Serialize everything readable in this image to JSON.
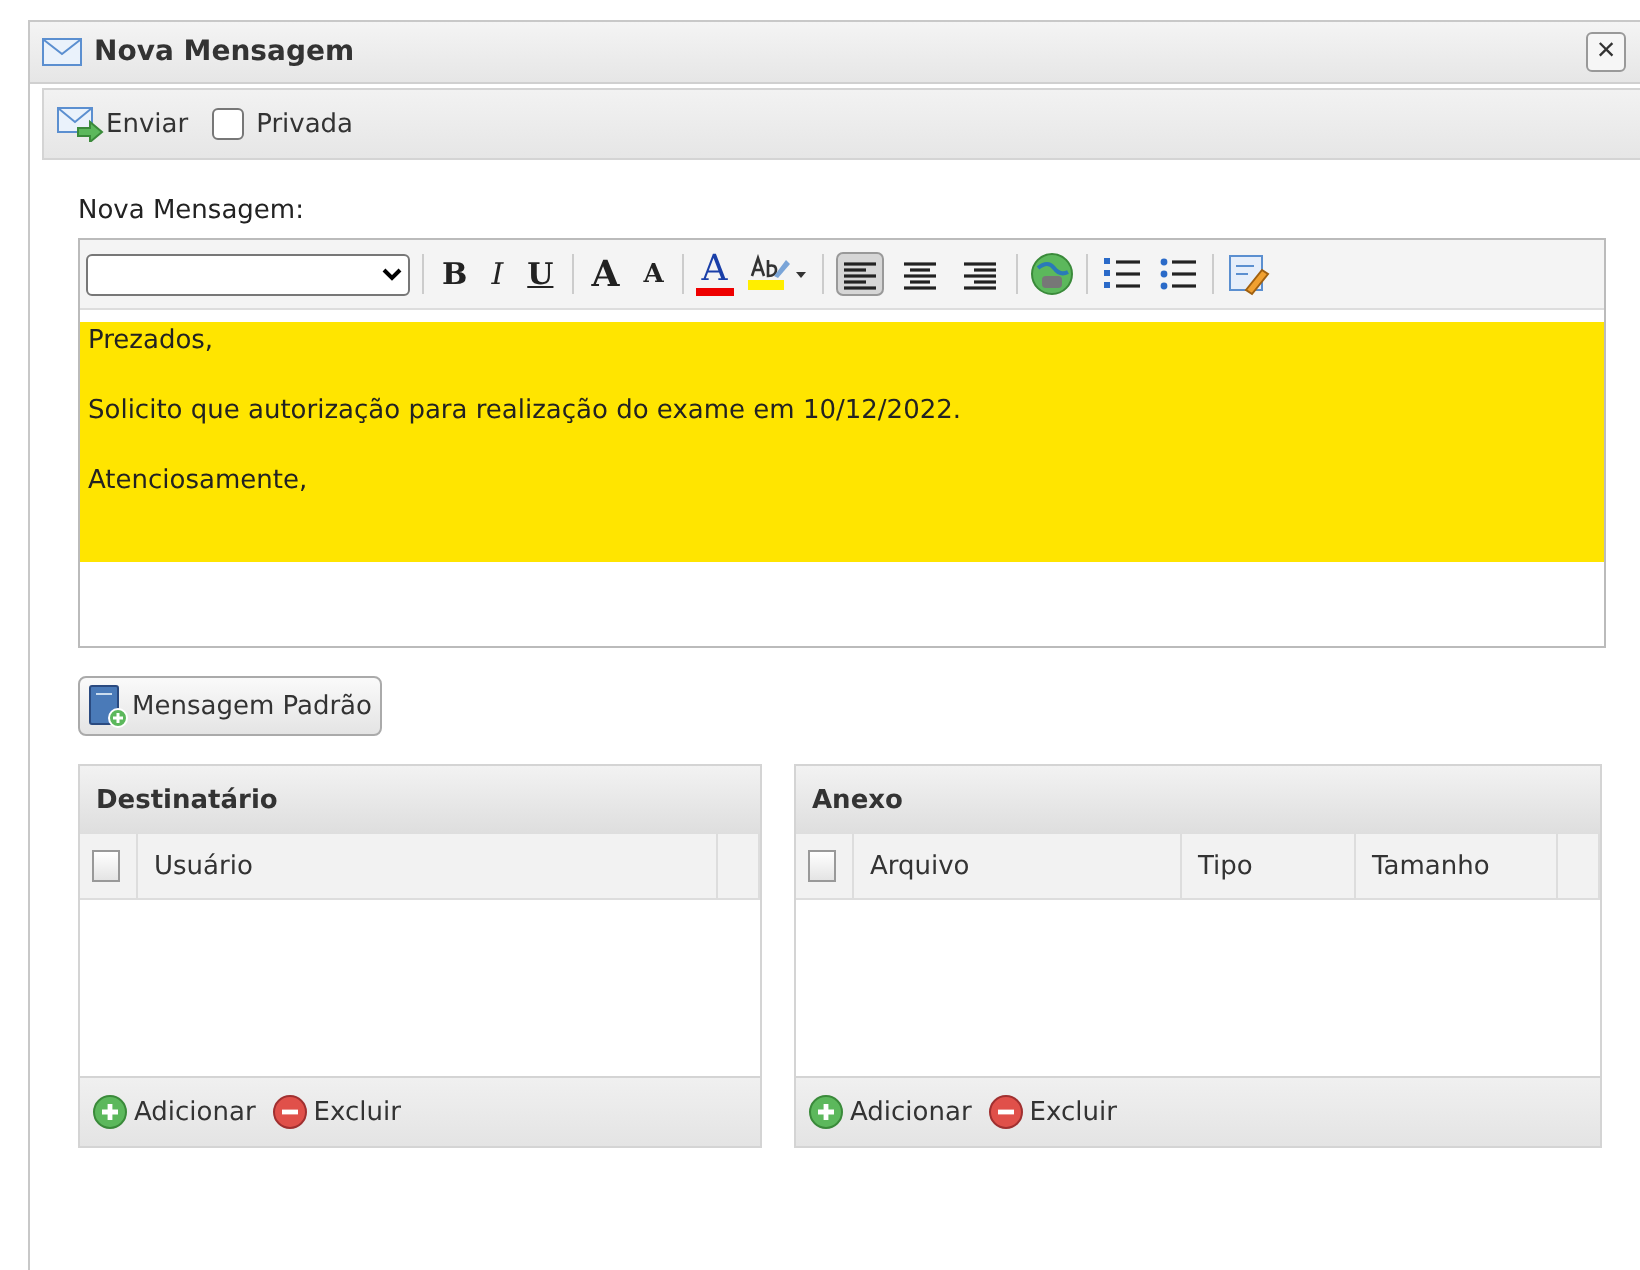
{
  "window": {
    "title": "Nova Mensagem",
    "close": "×"
  },
  "toolbar": {
    "send": "Enviar",
    "private": {
      "label": "Privada",
      "checked": false
    }
  },
  "editor": {
    "label": "Nova Mensagem:",
    "tools": [
      {
        "kind": "font"
      },
      {
        "kind": "sep"
      },
      {
        "kind": "bold",
        "label": "B"
      },
      {
        "kind": "italic",
        "label": "I"
      },
      {
        "kind": "underline",
        "label": "U"
      },
      {
        "kind": "sep"
      },
      {
        "kind": "grow",
        "label": "A"
      },
      {
        "kind": "shrink",
        "label": "A"
      },
      {
        "kind": "sep"
      },
      {
        "kind": "color",
        "label": "A"
      },
      {
        "kind": "highlight"
      },
      {
        "kind": "sep"
      },
      {
        "kind": "align-left",
        "selected": true
      },
      {
        "kind": "align-center",
        "selected": false
      },
      {
        "kind": "align-right",
        "selected": false
      },
      {
        "kind": "sep"
      },
      {
        "kind": "link"
      },
      {
        "kind": "sep"
      },
      {
        "kind": "ordered"
      },
      {
        "kind": "bullets"
      },
      {
        "kind": "sep"
      },
      {
        "kind": "source"
      }
    ],
    "paragraphs": [
      "Prezados,",
      "Solicito que autorização para realização do exame em 10/12/2022.",
      "Atenciosamente,"
    ]
  },
  "template_button": "Mensagem Padrão",
  "panels": [
    {
      "title": "Destinatário",
      "select_all": false,
      "columns": [
        "Usuário"
      ],
      "actions": [
        {
          "kind": "add",
          "label": "Adicionar"
        },
        {
          "kind": "remove",
          "label": "Excluir"
        }
      ]
    },
    {
      "title": "Anexo",
      "select_all": false,
      "columns": [
        "Arquivo",
        "Tipo",
        "Tamanho"
      ],
      "actions": [
        {
          "kind": "add",
          "label": "Adicionar"
        },
        {
          "kind": "remove",
          "label": "Excluir"
        }
      ]
    }
  ]
}
